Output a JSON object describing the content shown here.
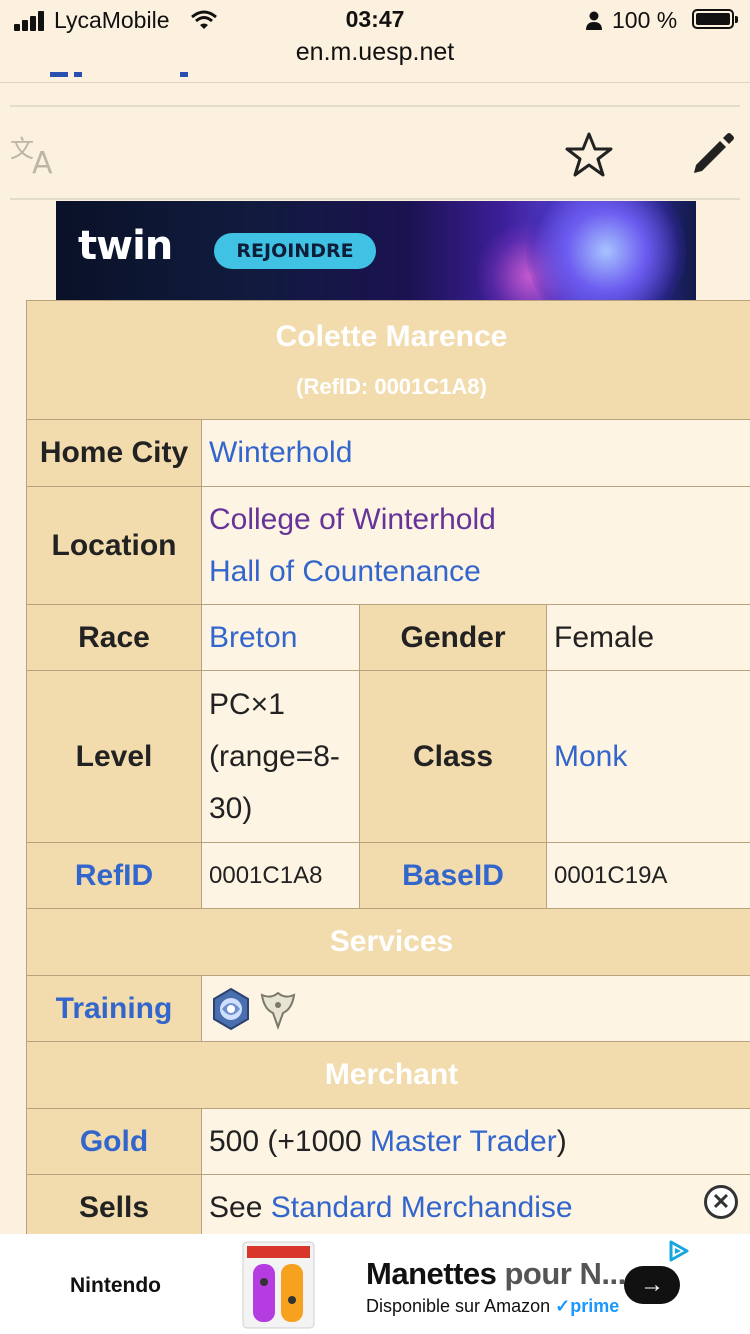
{
  "status_bar": {
    "carrier": "LycaMobile",
    "time": "03:47",
    "url": "en.m.uesp.net",
    "battery": "100 %"
  },
  "toolbar": {
    "translate_icon": "translate-icon",
    "watch_icon": "star-icon",
    "edit_icon": "pencil-icon"
  },
  "top_ad": {
    "brand": "twin",
    "cta": "REJOINDRE"
  },
  "infobox": {
    "name": "Colette Marence",
    "refid_title": "(RefID: 0001C1A8)",
    "home_city": {
      "label": "Home City",
      "value": "Winterhold"
    },
    "location": {
      "label": "Location",
      "values": [
        "College of Winterhold",
        "Hall of Countenance"
      ]
    },
    "race": {
      "label": "Race",
      "value": "Breton"
    },
    "gender": {
      "label": "Gender",
      "value": "Female"
    },
    "level": {
      "label": "Level",
      "lines": [
        "PC×1",
        "(range=8-",
        "30)"
      ]
    },
    "class": {
      "label": "Class",
      "value": "Monk"
    },
    "refid": {
      "label": "RefID",
      "value": "0001C1A8"
    },
    "baseid": {
      "label": "BaseID",
      "value": "0001C19A"
    },
    "services_header": "Services",
    "training": {
      "label": "Training",
      "icons": [
        "alteration-skill-icon",
        "restoration-skill-icon"
      ]
    },
    "merchant_header": "Merchant",
    "gold": {
      "label": "Gold",
      "prefix": "500 (+1000 ",
      "link": "Master Trader",
      "suffix": ")"
    },
    "sells": {
      "label": "Sells",
      "prefix": "See ",
      "link": "Standard Merchandise"
    }
  },
  "bottom_ad": {
    "brand": "Nintendo",
    "title_bold": "Manettes",
    "title_light": " pour N...",
    "subtitle": "Disponible sur Amazon",
    "prime": "prime",
    "go": "→"
  }
}
